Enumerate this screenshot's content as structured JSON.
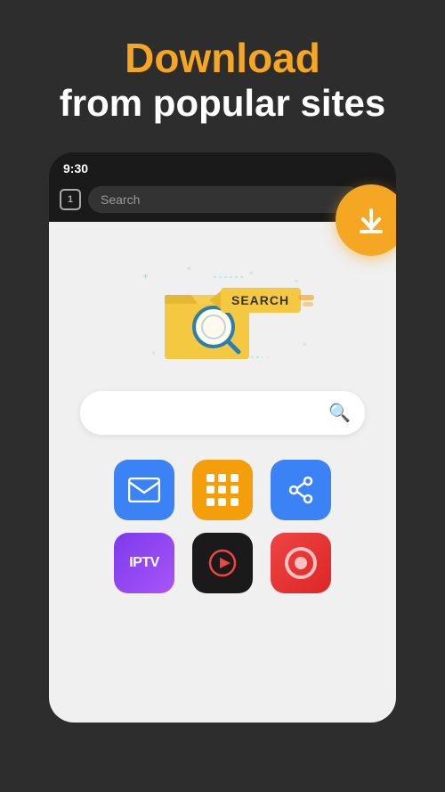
{
  "header": {
    "line1": "Download",
    "line2": "from popular sites"
  },
  "status_bar": {
    "time": "9:30"
  },
  "browser": {
    "tab_count": "1",
    "search_placeholder": "Search",
    "refresh_icon": "↻"
  },
  "download_fab": {
    "icon": "⬇",
    "aria": "Download button"
  },
  "search_bar": {
    "search_icon": "🔍"
  },
  "app_icons": {
    "row1": [
      {
        "name": "Mail",
        "type": "mail",
        "color": "#3b82f6"
      },
      {
        "name": "Grid",
        "type": "grid",
        "color": "#f59e0b"
      },
      {
        "name": "Share",
        "type": "share",
        "color": "#3b82f6"
      }
    ],
    "row2": [
      {
        "name": "IPTV",
        "type": "iptv",
        "label": "IPTV"
      },
      {
        "name": "Play",
        "type": "play",
        "color": "#1a1a1a"
      },
      {
        "name": "Music",
        "type": "music",
        "color": "#ef4444"
      }
    ]
  },
  "colors": {
    "accent_orange": "#f5a623",
    "bg_dark": "#2d2d2d",
    "bg_phone": "#1a1a1a",
    "bg_content": "#f0f0f0"
  }
}
